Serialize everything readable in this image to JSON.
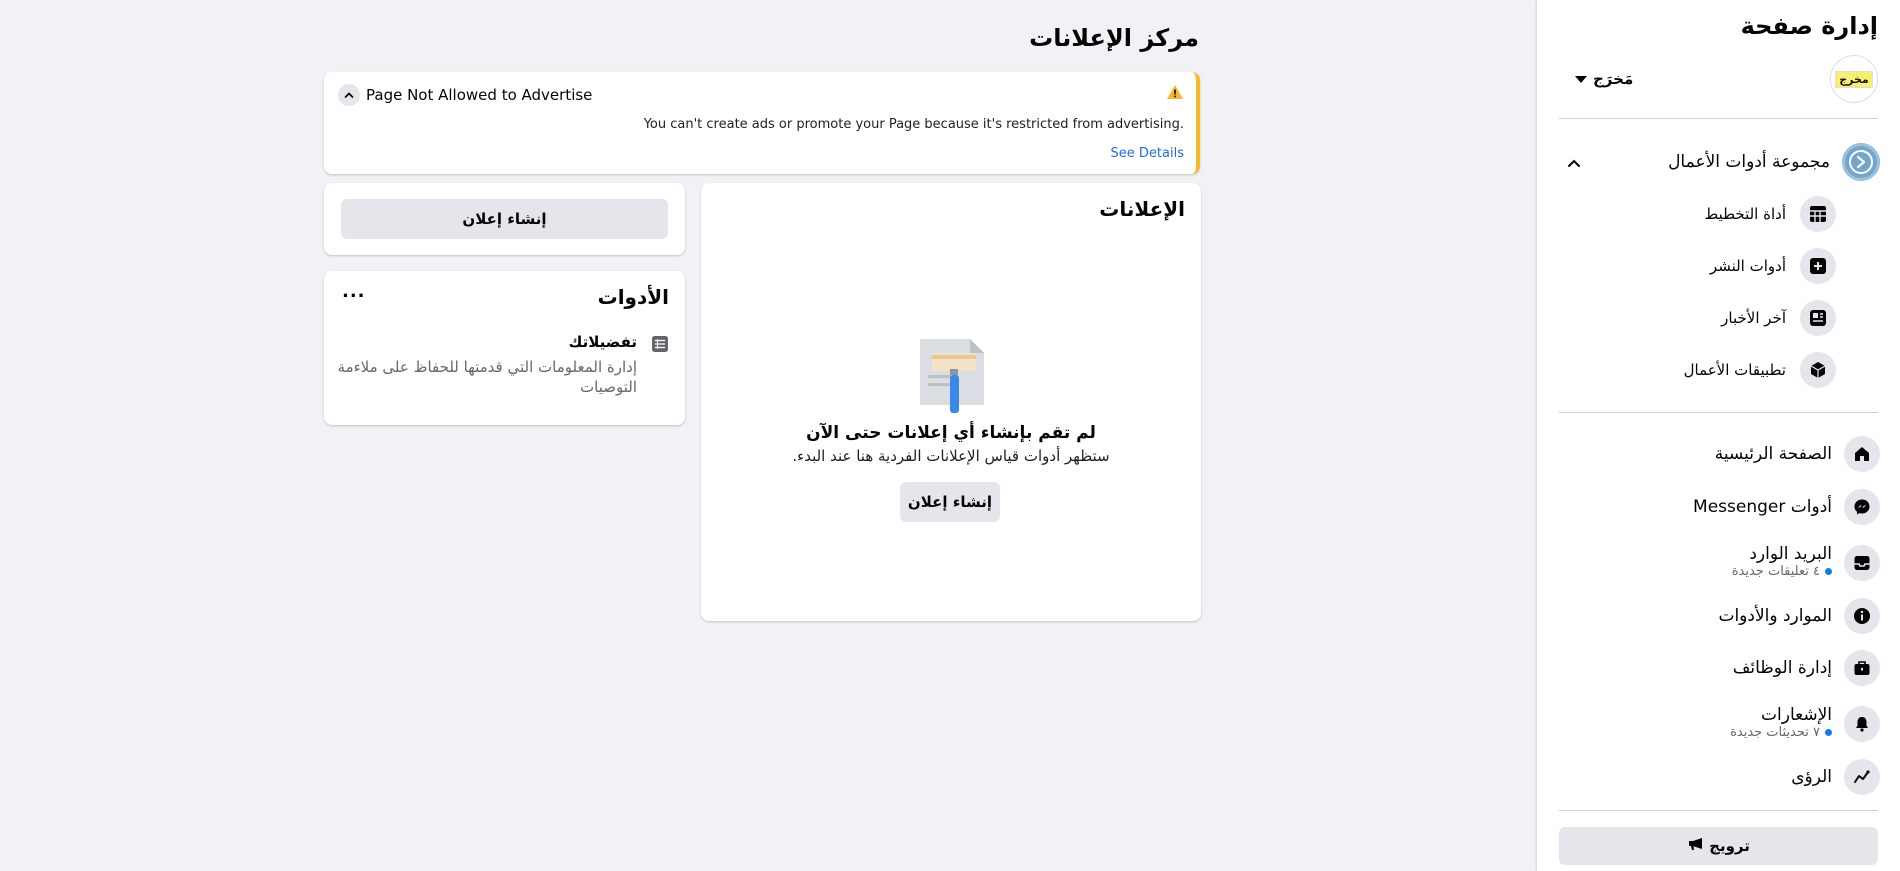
{
  "sidebar": {
    "title": "إدارة صفحة",
    "profile": {
      "avatar_text": "مخرج",
      "name": "مَخرَج"
    },
    "business_tools": {
      "label": "مجموعة أدوات الأعمال",
      "items": [
        {
          "label": "أداة التخطيط",
          "icon": "table-grid-icon"
        },
        {
          "label": "أدوات النشر",
          "icon": "publish-add-icon"
        },
        {
          "label": "آخر الأخبار",
          "icon": "news-feed-icon"
        },
        {
          "label": "تطبيقات الأعمال",
          "icon": "cube-icon"
        }
      ]
    },
    "nav": [
      {
        "label": "الصفحة الرئيسية",
        "icon": "home-icon"
      },
      {
        "label": "أدوات Messenger",
        "icon": "messenger-icon"
      },
      {
        "label": "البريد الوارد",
        "sub": "٤ تعليقات جديدة",
        "icon": "inbox-icon"
      },
      {
        "label": "الموارد والأدوات",
        "icon": "info-icon"
      },
      {
        "label": "إدارة الوظائف",
        "icon": "briefcase-icon"
      },
      {
        "label": "الإشعارات",
        "sub": "٧ تحديثات جديدة",
        "icon": "bell-icon"
      },
      {
        "label": "الرؤى",
        "icon": "insights-chart-icon"
      }
    ],
    "promote_label": "ترويج"
  },
  "main": {
    "title": "مركز الإعلانات",
    "alert": {
      "title": "Page Not Allowed to Advertise",
      "message": "You can't create ads or promote your Page because it's restricted from advertising.",
      "link": "See Details"
    },
    "ads_card": {
      "title": "الإعلانات",
      "empty_title": "لم تقم بإنشاء أي إعلانات حتى الآن",
      "empty_subtitle": "ستظهر أدوات قياس الإعلانات الفردية هنا عند البدء.",
      "create_label": "إنشاء إعلان"
    },
    "create_card": {
      "create_label": "إنشاء إعلان"
    },
    "tools_card": {
      "title": "الأدوات",
      "more": "...",
      "pref_title": "تفضيلاتك",
      "pref_desc": "إدارة المعلومات التي قدمتها للحفاظ على ملاءمة التوصيات"
    }
  },
  "colors": {
    "background": "#f0f2f5",
    "card": "#ffffff",
    "button_gray": "#e4e6eb",
    "warning": "#f7b928",
    "link": "#216fdb",
    "badge_dot": "#1877f2"
  }
}
